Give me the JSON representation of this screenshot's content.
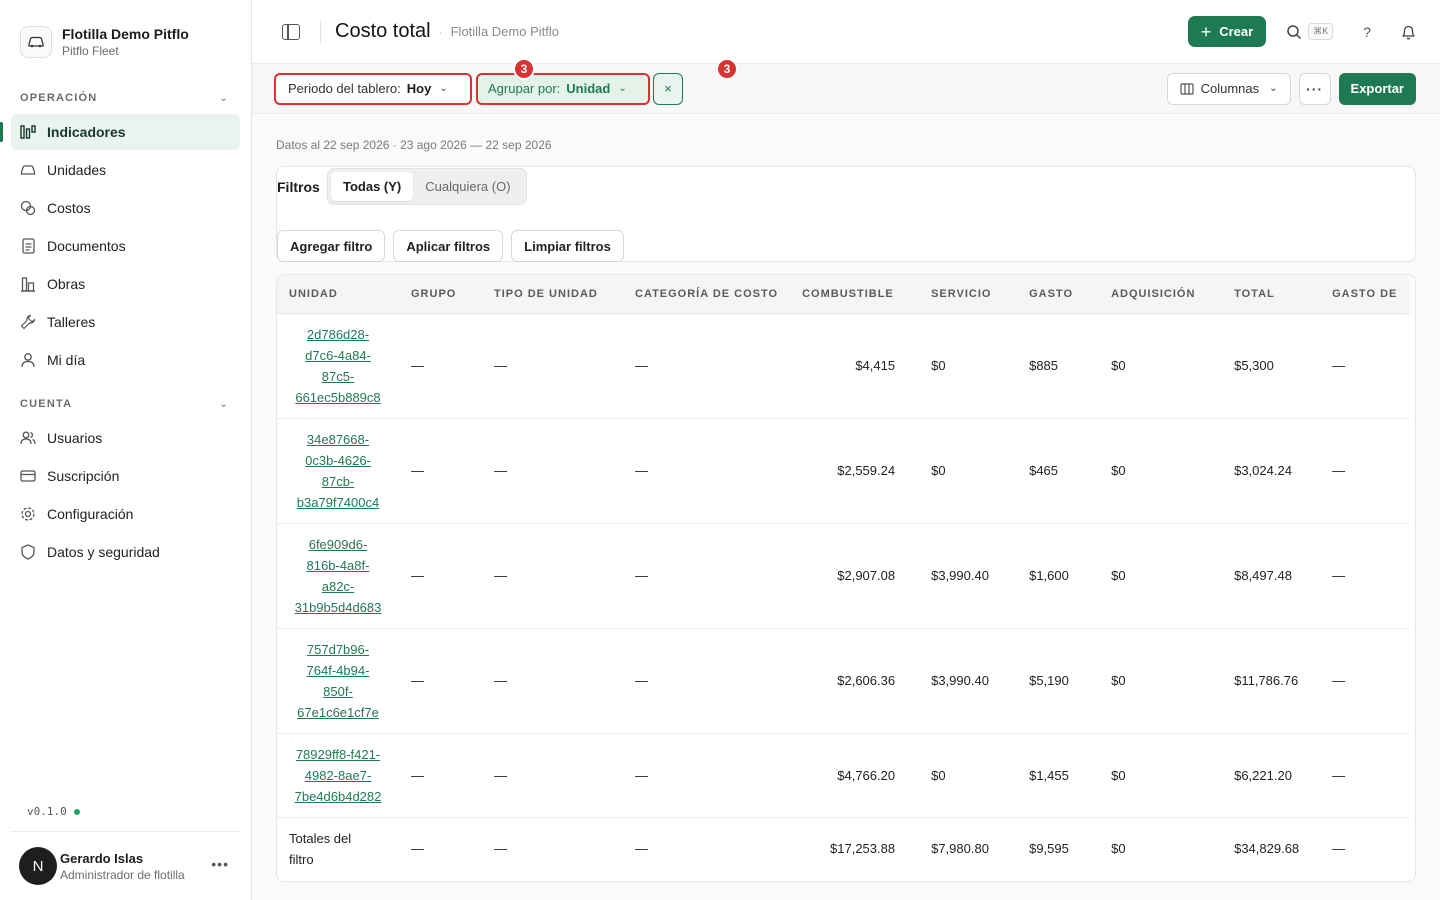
{
  "org": {
    "name": "Flotilla Demo Pitflo",
    "sub": "Pitflo Fleet"
  },
  "sections": {
    "operacion": "OPERACIÓN",
    "cuenta": "CUENTA"
  },
  "nav_operacion": [
    {
      "label": "Indicadores",
      "icon": "chart-icon"
    },
    {
      "label": "Unidades",
      "icon": "car-icon"
    },
    {
      "label": "Costos",
      "icon": "coins-icon"
    },
    {
      "label": "Documentos",
      "icon": "document-icon"
    },
    {
      "label": "Obras",
      "icon": "building-icon"
    },
    {
      "label": "Talleres",
      "icon": "wrench-icon"
    },
    {
      "label": "Mi día",
      "icon": "person-icon"
    }
  ],
  "nav_cuenta": [
    {
      "label": "Usuarios",
      "icon": "users-icon"
    },
    {
      "label": "Suscripción",
      "icon": "card-icon"
    },
    {
      "label": "Configuración",
      "icon": "gear-icon"
    },
    {
      "label": "Datos y seguridad",
      "icon": "shield-icon"
    }
  ],
  "version": "v0.1.0",
  "user": {
    "initial": "N",
    "name": "Gerardo Islas",
    "role": "Administrador de flotilla"
  },
  "header": {
    "title": "Costo total",
    "subtitle": "Flotilla Demo Pitflo",
    "create_label": "Crear",
    "shortcut": "⌘K",
    "help": "?"
  },
  "toolbar": {
    "period_label": "Periodo del tablero:",
    "period_value": "Hoy",
    "group_label": "Agrupar por:",
    "group_value": "Unidad",
    "clear_symbol": "×",
    "badge_period": "3",
    "badge_group": "3",
    "columns_label": "Columnas",
    "more_label": "···",
    "export_label": "Exportar"
  },
  "datainfo": "Datos al 22 sep 2026 · 23 ago 2026 — 22 sep 2026",
  "filters": {
    "label": "Filtros",
    "mode_all": "Todas (Y)",
    "mode_any": "Cualquiera (O)",
    "add": "Agregar filtro",
    "apply": "Aplicar filtros",
    "clear": "Limpiar filtros"
  },
  "table": {
    "columns": [
      "UNIDAD",
      "GRUPO",
      "TIPO DE UNIDAD",
      "CATEGORÍA DE COSTO",
      "COMBUSTIBLE",
      "SERVICIO",
      "GASTO",
      "ADQUISICIÓN",
      "TOTAL",
      "GASTO DE "
    ],
    "rows": [
      {
        "unit": [
          "2d786d28-",
          "d7c6-4a84-",
          "87c5-",
          "661ec5b889c8"
        ],
        "grupo": "—",
        "tipo": "—",
        "categoria": "—",
        "combustible": "$4,415",
        "servicio": "$0",
        "gasto": "$885",
        "adquisicion": "$0",
        "total": "$5,300",
        "gasto_de": "—"
      },
      {
        "unit": [
          "34e87668-",
          "0c3b-4626-",
          "87cb-",
          "b3a79f7400c4"
        ],
        "grupo": "—",
        "tipo": "—",
        "categoria": "—",
        "combustible": "$2,559.24",
        "servicio": "$0",
        "gasto": "$465",
        "adquisicion": "$0",
        "total": "$3,024.24",
        "gasto_de": "—"
      },
      {
        "unit": [
          "6fe909d6-",
          "816b-4a8f-",
          "a82c-",
          "31b9b5d4d683"
        ],
        "grupo": "—",
        "tipo": "—",
        "categoria": "—",
        "combustible": "$2,907.08",
        "servicio": "$3,990.40",
        "gasto": "$1,600",
        "adquisicion": "$0",
        "total": "$8,497.48",
        "gasto_de": "—"
      },
      {
        "unit": [
          "757d7b96-",
          "764f-4b94-",
          "850f-",
          "67e1c6e1cf7e"
        ],
        "grupo": "—",
        "tipo": "—",
        "categoria": "—",
        "combustible": "$2,606.36",
        "servicio": "$3,990.40",
        "gasto": "$5,190",
        "adquisicion": "$0",
        "total": "$11,786.76",
        "gasto_de": "—"
      },
      {
        "unit": [
          "78929ff8-f421-",
          "4982-8ae7-",
          "7be4d6b4d282"
        ],
        "grupo": "—",
        "tipo": "—",
        "categoria": "—",
        "combustible": "$4,766.20",
        "servicio": "$0",
        "gasto": "$1,455",
        "adquisicion": "$0",
        "total": "$6,221.20",
        "gasto_de": "—"
      }
    ],
    "totals": {
      "label_1": "Totales del",
      "label_2": "filtro",
      "grupo": "—",
      "tipo": "—",
      "categoria": "—",
      "combustible": "$17,253.88",
      "servicio": "$7,980.80",
      "gasto": "$9,595",
      "adquisicion": "$0",
      "total": "$34,829.68",
      "gasto_de": "—"
    }
  },
  "colors": {
    "accent": "#1e7a52",
    "highlight": "#d93232",
    "active_nav_bg": "#e9f4ee"
  }
}
